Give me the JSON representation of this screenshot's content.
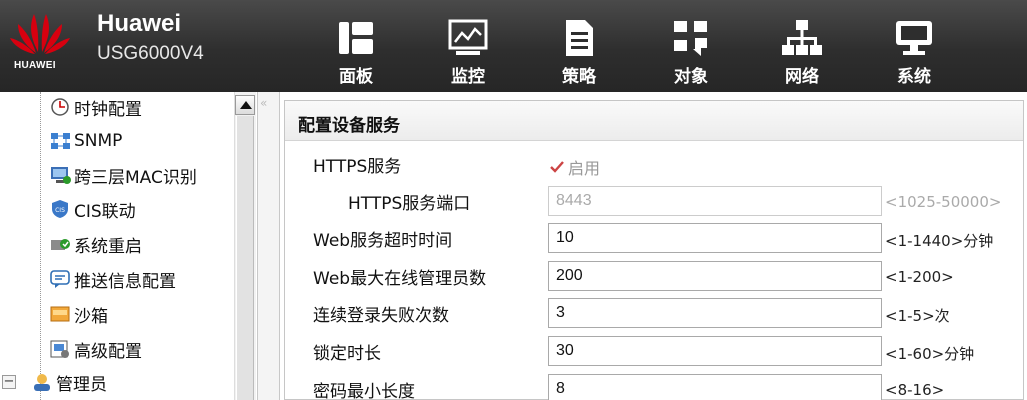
{
  "header": {
    "logo_text": "HUAWEI",
    "brand_name": "Huawei",
    "model": "USG6000V4",
    "nav": [
      {
        "label": "面板",
        "icon": "dashboard-icon"
      },
      {
        "label": "监控",
        "icon": "monitor-icon"
      },
      {
        "label": "策略",
        "icon": "policy-icon"
      },
      {
        "label": "对象",
        "icon": "object-icon"
      },
      {
        "label": "网络",
        "icon": "network-icon"
      },
      {
        "label": "系统",
        "icon": "system-icon"
      }
    ]
  },
  "sidebar": {
    "items": [
      {
        "label": "时钟配置",
        "icon": "clock-icon"
      },
      {
        "label": "SNMP",
        "icon": "snmp-icon"
      },
      {
        "label": "跨三层MAC识别",
        "icon": "mac-recognition-icon"
      },
      {
        "label": "CIS联动",
        "icon": "cis-shield-icon"
      },
      {
        "label": "系统重启",
        "icon": "restart-icon"
      },
      {
        "label": "推送信息配置",
        "icon": "push-message-icon"
      },
      {
        "label": "沙箱",
        "icon": "sandbox-icon"
      },
      {
        "label": "高级配置",
        "icon": "advanced-config-icon"
      },
      {
        "label": "管理员",
        "icon": "admin-icon"
      }
    ],
    "collapse_glyph": "«",
    "expander_glyph": "−"
  },
  "main": {
    "title": "配置设备服务",
    "https": {
      "label": "HTTPS服务",
      "checkbox_label": "启用",
      "checked": true
    },
    "fields": [
      {
        "label": "HTTPS服务端口",
        "value": "8443",
        "hint": "<1025-50000>",
        "disabled": true
      },
      {
        "label": "Web服务超时时间",
        "value": "10",
        "hint": "<1-1440>分钟",
        "disabled": false
      },
      {
        "label": "Web最大在线管理员数",
        "value": "200",
        "hint": "<1-200>",
        "disabled": false
      },
      {
        "label": "连续登录失败次数",
        "value": "3",
        "hint": "<1-5>次",
        "disabled": false
      },
      {
        "label": "锁定时长",
        "value": "30",
        "hint": "<1-60>分钟",
        "disabled": false
      },
      {
        "label": "密码最小长度",
        "value": "8",
        "hint": "<8-16>",
        "disabled": false
      }
    ]
  },
  "colors": {
    "header_bg": "#2e2e2e",
    "logo_red": "#d7000f",
    "check_red": "#cc2222"
  }
}
